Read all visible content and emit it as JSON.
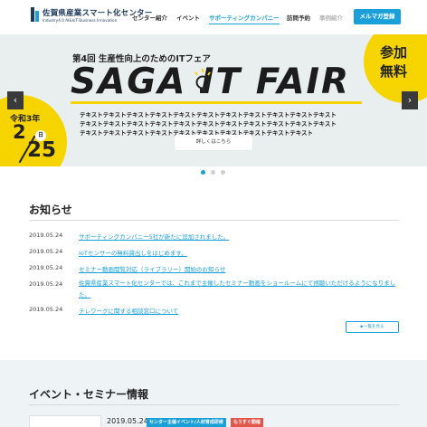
{
  "header": {
    "logo_title": "佐賀県産業スマート化センター",
    "logo_subtitle": "Industry4.0 AI&IoT Business Innovation",
    "nav": [
      "センター紹介",
      "イベント",
      "サポーティングカンパニー",
      "訪問予約",
      "事例紹介"
    ],
    "cta_label": "メルマガ登録",
    "accent_color": "#1a9fd9"
  },
  "hero": {
    "edition": "第4回 生産性向上のためのITフェア",
    "title": "SAGA IT FAIR",
    "text_lines": [
      "テキストテキストテキストテキストテキストテキストテキストテキストテキストテキストテキスト",
      "テキストテキストテキストテキストテキストテキストテキストテキストテキストテキストテキスト",
      "テキストテキストテキストテキストテキストテキストテキストテキストテキストテキスト"
    ],
    "detail_button": "詳しくはこちら",
    "badge_free": [
      "参加",
      "無料"
    ],
    "date_era": "令和3年",
    "date_month": "2",
    "date_day": "25",
    "date_dow": "日",
    "prev_icon": "‹",
    "next_icon": "›",
    "slide_count": 3,
    "active_slide": 1,
    "highlight_color": "#f5d400"
  },
  "news": {
    "heading": "お知らせ",
    "items": [
      {
        "date": "2019.05.24",
        "text": "サポーティングカンパニー5社が新たに追加されました。"
      },
      {
        "date": "2019.05.24",
        "text": "IoTセンサーの無料貸出しをはじめます。"
      },
      {
        "date": "2019.05.24",
        "text": "セミナー動画閲覧対応（ライブラリー）開始のお知らせ"
      },
      {
        "date": "2019.05.24",
        "text": "佐賀県産業スマート化センターでは、これまで主催したセミナー動画をショールームにて視聴いただけるようになりました。"
      },
      {
        "date": "2019.05.24",
        "text": "テレワークに関する相談窓口について"
      }
    ],
    "more_button": "▶一覧を見る"
  },
  "events": {
    "heading": "イベント・セミナー情報",
    "first_date": "2019.05.24",
    "tags": [
      {
        "label": "センター主催イベント/人材育成研修",
        "color": "#1a9fd9"
      },
      {
        "label": "もうすぐ開催",
        "color": "#e2574c"
      }
    ]
  }
}
